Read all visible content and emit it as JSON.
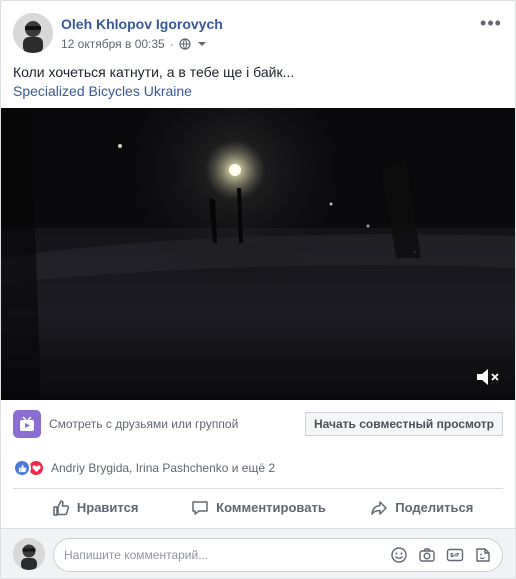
{
  "post": {
    "author": "Oleh Khlopov Igorovych",
    "timestamp": "12 октября в 00:35",
    "privacy_icon": "globe-icon",
    "options_label": "•••",
    "text": "Коли хочеться катнути, а в тебе ще і байк...",
    "mention": "Specialized Bicycles Ukraine"
  },
  "video": {
    "muted_icon": "volume-muted-icon"
  },
  "watch_party": {
    "label": "Смотреть с друзьями или группой",
    "button": "Начать совместный просмотр"
  },
  "reactions": {
    "icons": [
      "like-icon",
      "love-icon"
    ],
    "summary": "Andriy Brygida, Irina Pashchenko и ещё 2"
  },
  "actions": {
    "like": "Нравится",
    "comment": "Комментировать",
    "share": "Поделиться"
  },
  "comment": {
    "placeholder": "Напишите комментарий...",
    "tools": [
      "emoji-icon",
      "camera-icon",
      "gif-icon",
      "sticker-icon"
    ]
  },
  "colors": {
    "link": "#385898",
    "watch_accent": "#8b6fd0",
    "like": "#4a7bdc",
    "love": "#f0284a"
  }
}
